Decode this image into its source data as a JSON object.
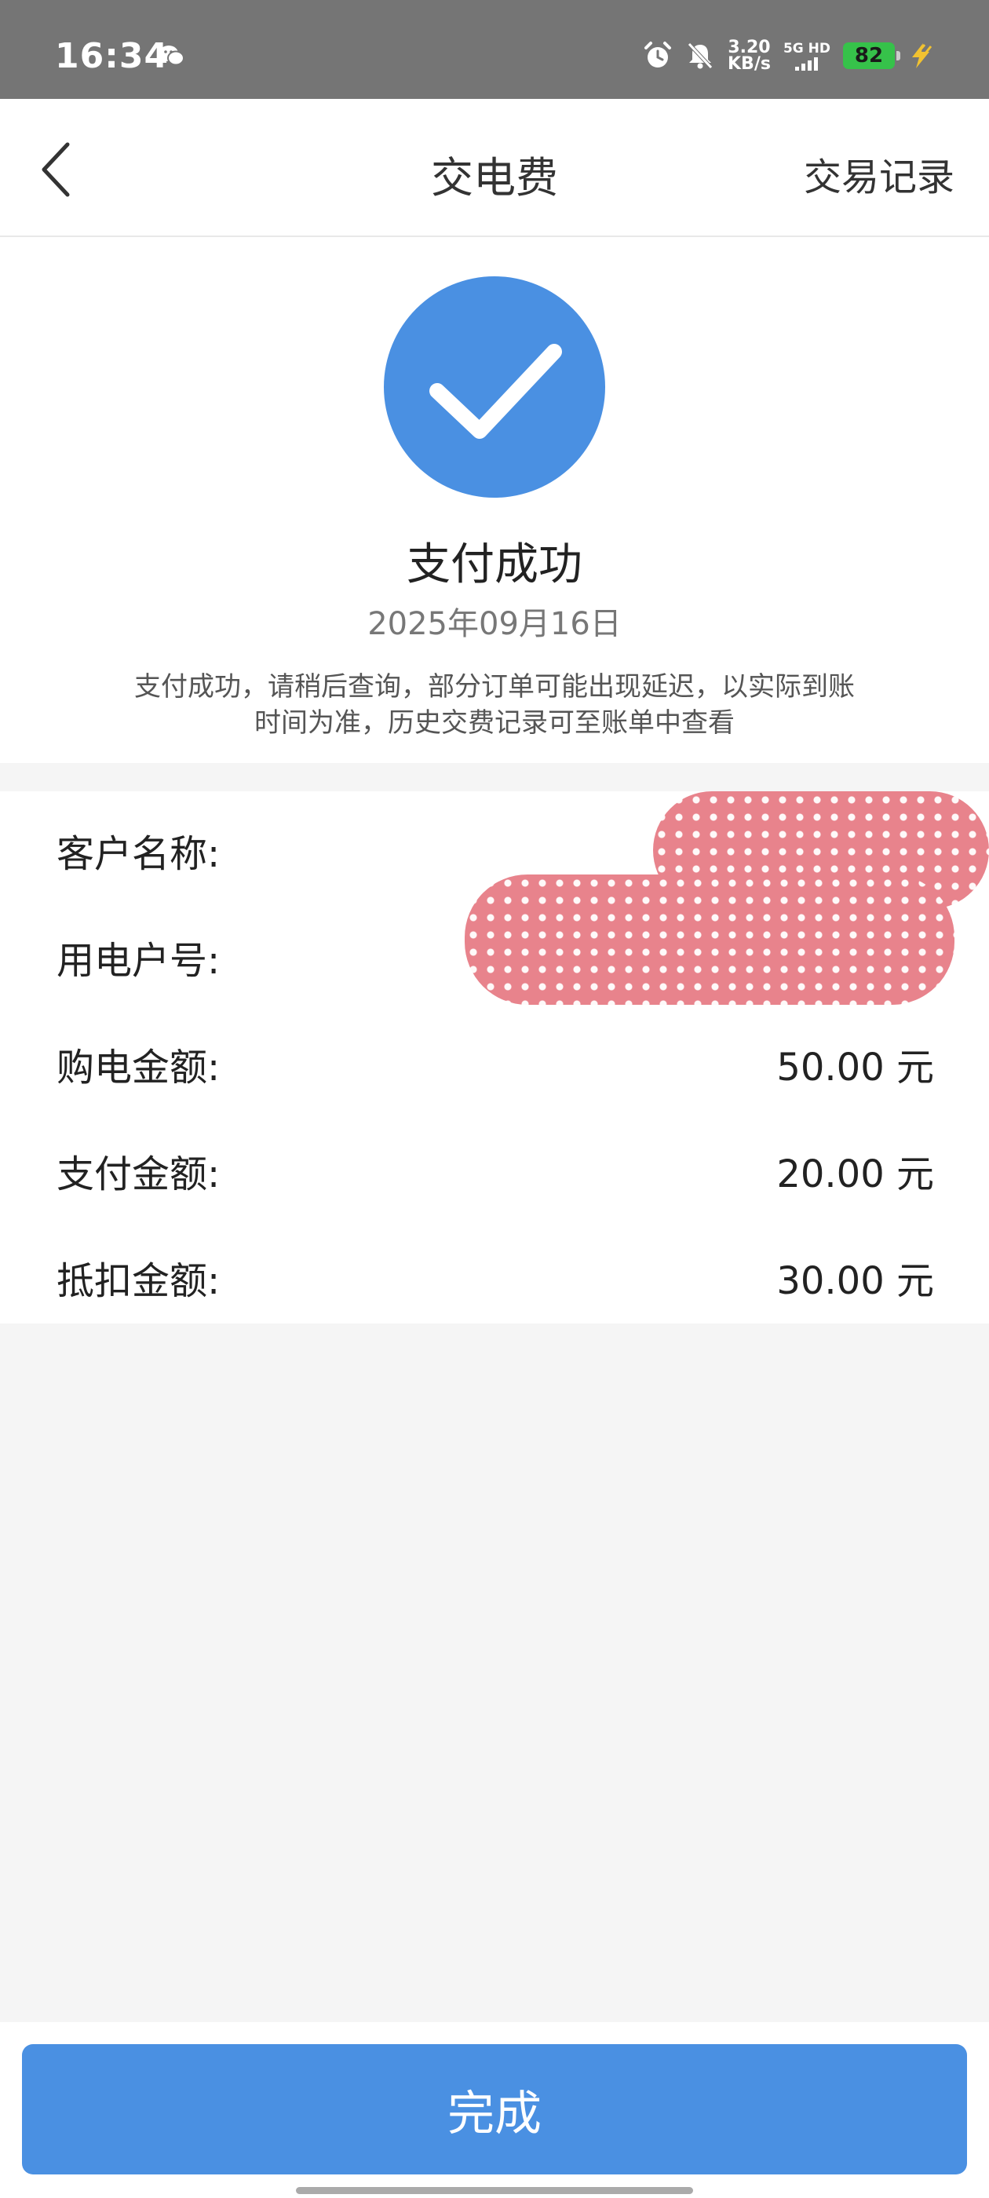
{
  "status_bar": {
    "time": "16:34",
    "net_speed_value": "3.20",
    "net_speed_unit": "KB/s",
    "signal_label": "5G HD",
    "battery": "82",
    "icons": [
      "wechat-icon",
      "alarm-icon",
      "mute-icon",
      "signal-icon",
      "battery-icon",
      "charging-icon"
    ]
  },
  "header": {
    "title": "交电费",
    "record_link": "交易记录"
  },
  "result": {
    "title": "支付成功",
    "date": "2025年09月16日",
    "note": "支付成功，请稍后查询，部分订单可能出现延迟，以实际到账时间为准，历史交费记录可至账单中查看",
    "accent_color": "#4a90e2"
  },
  "details": {
    "rows": [
      {
        "label": "客户名称:",
        "value": ""
      },
      {
        "label": "用电户号:",
        "value": ""
      },
      {
        "label": "购电金额:",
        "value": "50.00 元"
      },
      {
        "label": "支付金额:",
        "value": "20.00 元"
      },
      {
        "label": "抵扣金额:",
        "value": "30.00 元"
      }
    ]
  },
  "footer": {
    "done_label": "完成"
  }
}
